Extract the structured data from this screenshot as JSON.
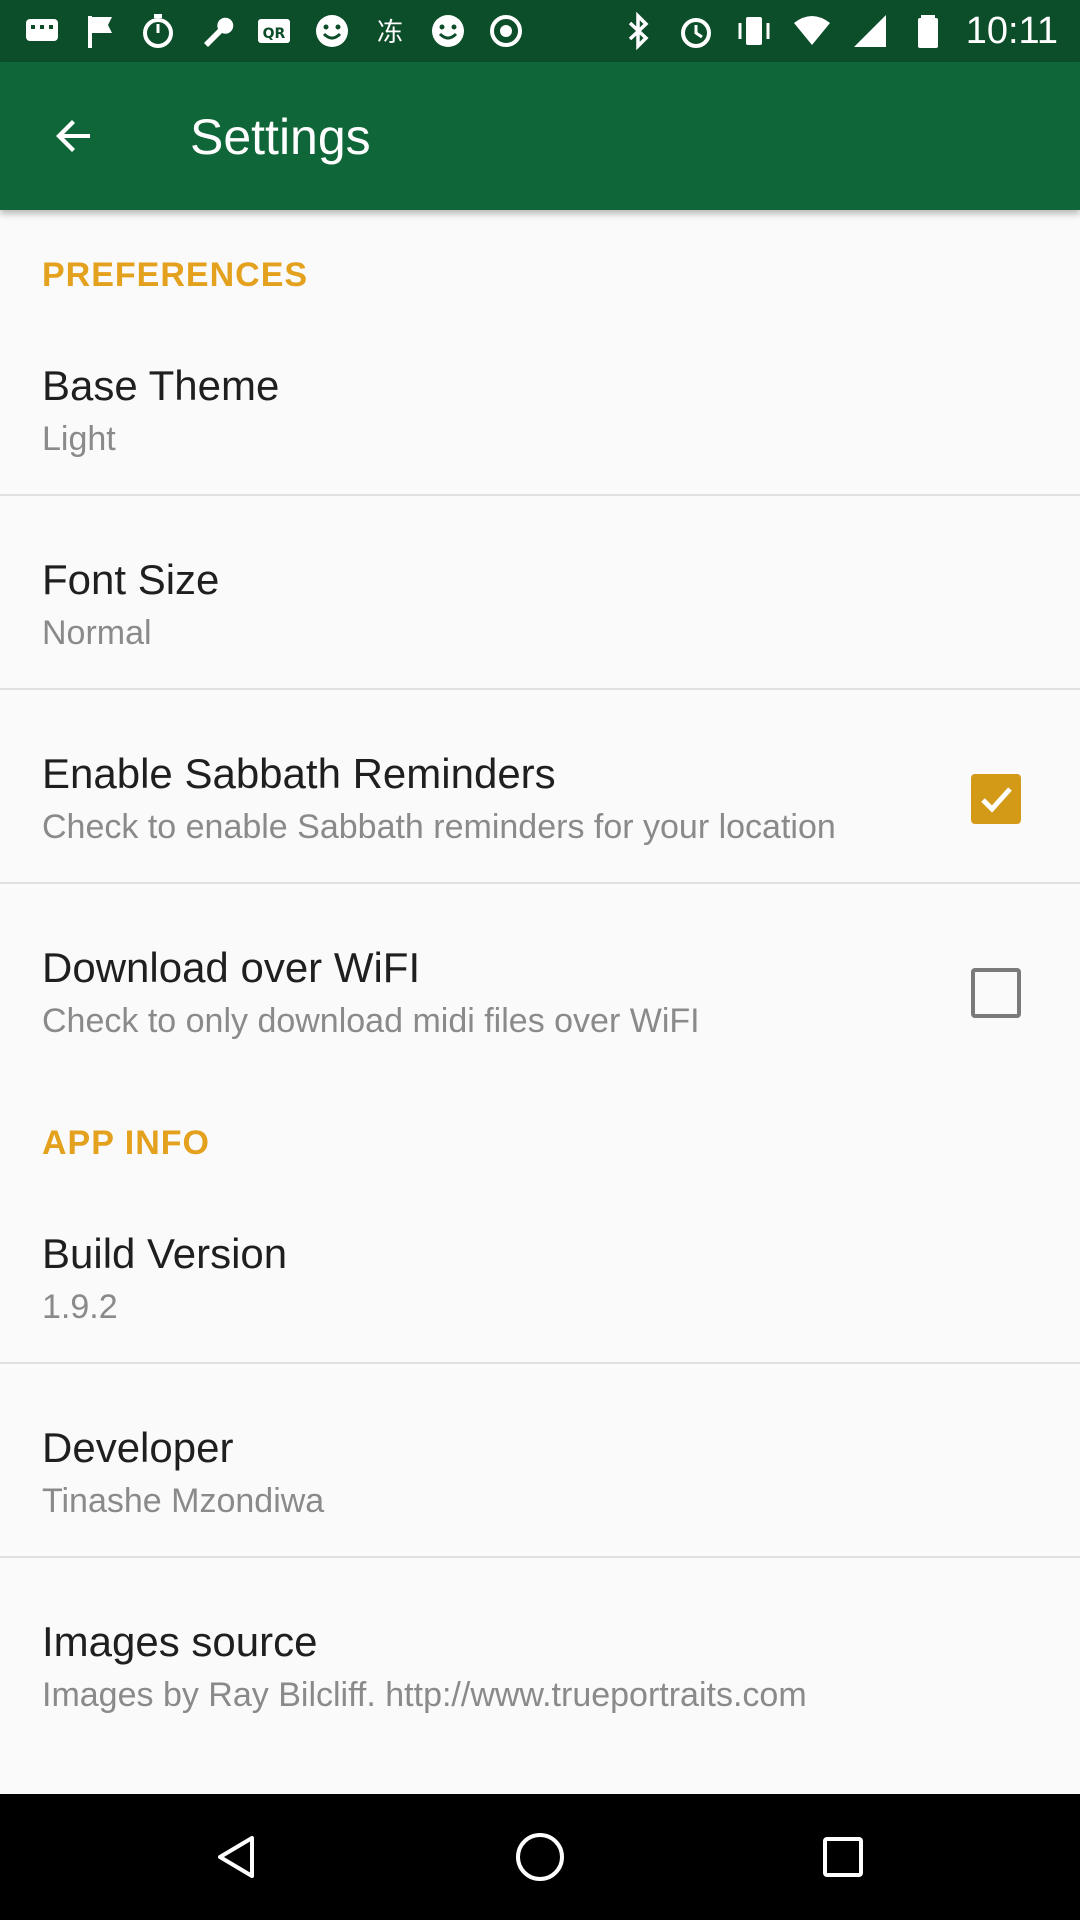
{
  "status_bar": {
    "time": "10:11",
    "left_icons": [
      "message-icon",
      "flag-icon",
      "timer-icon",
      "wrench-icon",
      "qr-icon",
      "smiley-icon",
      "chinese-char-icon",
      "smiley-icon",
      "record-icon"
    ],
    "right_icons": [
      "bluetooth-icon",
      "alarm-icon",
      "vibrate-icon",
      "wifi-icon",
      "signal-icon",
      "battery-icon"
    ]
  },
  "app_bar": {
    "title": "Settings",
    "back_icon": "back-arrow-icon"
  },
  "sections": {
    "preferences": {
      "header": "PREFERENCES",
      "items": [
        {
          "title": "Base Theme",
          "summary": "Light"
        },
        {
          "title": "Font Size",
          "summary": "Normal"
        },
        {
          "title": "Enable Sabbath Reminders",
          "summary": "Check to enable Sabbath reminders for your location",
          "checked": true
        },
        {
          "title": "Download over WiFI",
          "summary": "Check to only download midi files over WiFI",
          "checked": false
        }
      ]
    },
    "app_info": {
      "header": "APP INFO",
      "items": [
        {
          "title": "Build Version",
          "summary": "1.9.2"
        },
        {
          "title": "Developer",
          "summary": "Tinashe Mzondiwa"
        },
        {
          "title": "Images source",
          "summary": "Images by Ray Bilcliff. http://www.trueportraits.com"
        }
      ]
    }
  },
  "colors": {
    "status_bar": "#0c4d2a",
    "app_bar": "#0f6638",
    "accent": "#e3a11d",
    "checkbox_checked": "#d39a17"
  },
  "nav_bar": {
    "icons": [
      "back-triangle-icon",
      "home-circle-icon",
      "recents-square-icon"
    ]
  }
}
